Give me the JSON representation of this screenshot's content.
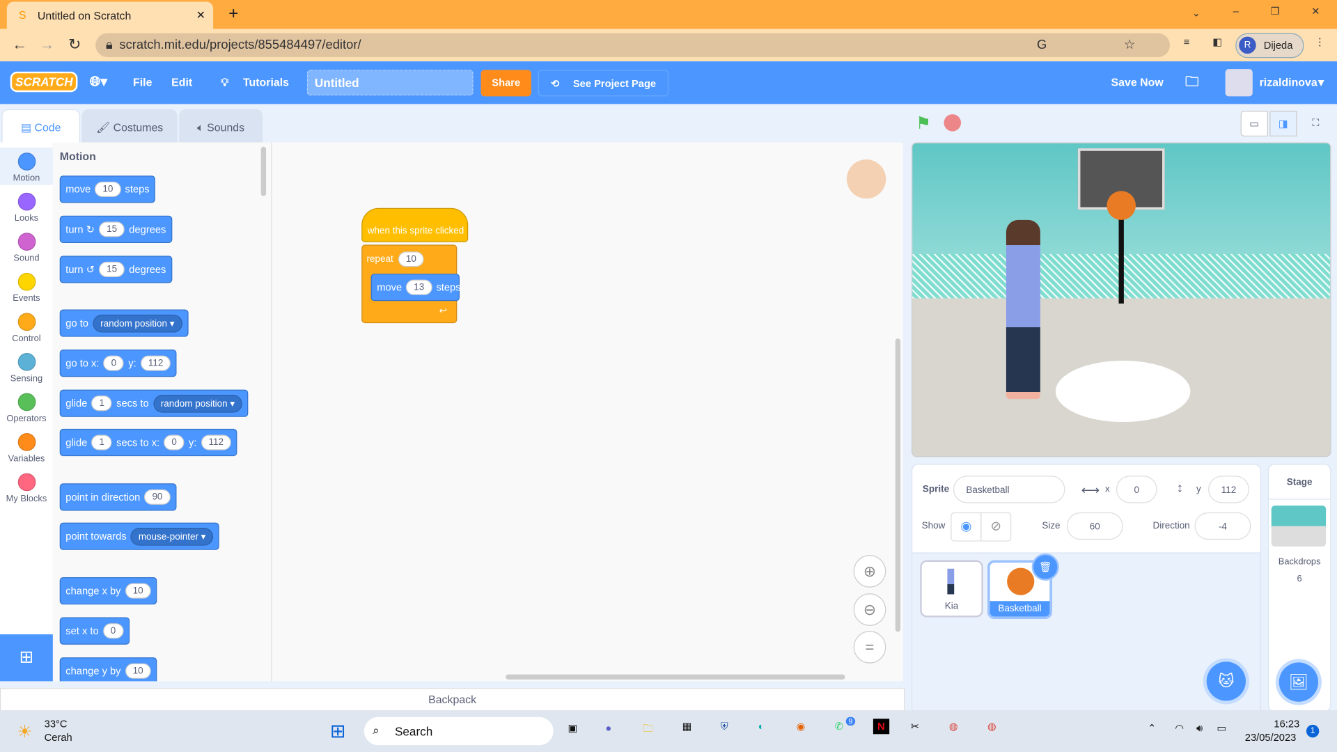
{
  "browser": {
    "tab_title": "Untitled on Scratch",
    "url": "scratch.mit.edu/projects/855484497/editor/",
    "profile": "Dijeda",
    "profile_initial": "R"
  },
  "menu": {
    "logo": "SCRATCH",
    "file": "File",
    "edit": "Edit",
    "tutorials": "Tutorials",
    "project_title": "Untitled",
    "share": "Share",
    "see_project_page": "See Project Page",
    "save_now": "Save Now",
    "username": "rizaldinova"
  },
  "editor_tabs": [
    "Code",
    "Costumes",
    "Sounds"
  ],
  "categories": [
    {
      "label": "Motion",
      "color": "#4c97ff"
    },
    {
      "label": "Looks",
      "color": "#9966ff"
    },
    {
      "label": "Sound",
      "color": "#cf63cf"
    },
    {
      "label": "Events",
      "color": "#ffd500"
    },
    {
      "label": "Control",
      "color": "#ffab19"
    },
    {
      "label": "Sensing",
      "color": "#5cb1d6"
    },
    {
      "label": "Operators",
      "color": "#59c059"
    },
    {
      "label": "Variables",
      "color": "#ff8c1a"
    },
    {
      "label": "My Blocks",
      "color": "#ff6680"
    }
  ],
  "palette": {
    "heading": "Motion",
    "blocks": [
      [
        "move",
        "10",
        "steps"
      ],
      [
        "turn ↻",
        "15",
        "degrees"
      ],
      [
        "turn ↺",
        "15",
        "degrees"
      ],
      [
        "go to",
        "random position ▾"
      ],
      [
        "go to x:",
        "0",
        "y:",
        "112"
      ],
      [
        "glide",
        "1",
        "secs to",
        "random position ▾"
      ],
      [
        "glide",
        "1",
        "secs to x:",
        "0",
        "y:",
        "112"
      ],
      [
        "point in direction",
        "90"
      ],
      [
        "point towards",
        "mouse-pointer ▾"
      ],
      [
        "change x by",
        "10"
      ],
      [
        "set x to",
        "0"
      ],
      [
        "change y by",
        "10"
      ]
    ]
  },
  "script": {
    "hat": "when this sprite clicked",
    "repeat": "repeat",
    "repeat_count": "10",
    "move": "move",
    "move_steps": "13",
    "steps": "steps"
  },
  "backpack": "Backpack",
  "sprite_info": {
    "sprite_label": "Sprite",
    "sprite_name": "Basketball",
    "x_label": "x",
    "x": "0",
    "y_label": "y",
    "y": "112",
    "show_label": "Show",
    "size_label": "Size",
    "size": "60",
    "direction_label": "Direction",
    "direction": "-4"
  },
  "sprites": [
    {
      "name": "Kia"
    },
    {
      "name": "Basketball",
      "selected": true
    }
  ],
  "stage_panel": {
    "title": "Stage",
    "backdrops_label": "Backdrops",
    "backdrops_count": "6"
  },
  "taskbar": {
    "temp": "33°C",
    "weather": "Cerah",
    "search": "Search",
    "time": "16:23",
    "date": "23/05/2023",
    "whatsapp_badge": "9",
    "notif": "1"
  }
}
